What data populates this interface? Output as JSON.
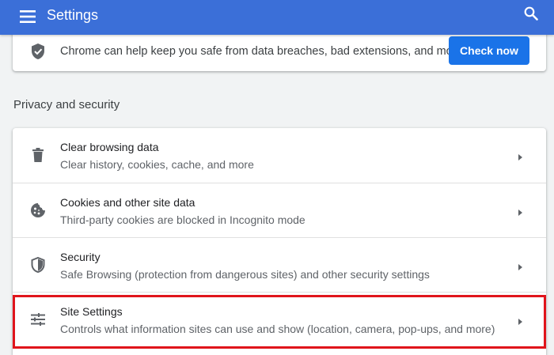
{
  "header": {
    "title": "Settings",
    "menu_icon": "hamburger-menu-icon",
    "search_icon": "search-icon",
    "background_color": "#3b6fd8"
  },
  "safety_check": {
    "icon": "shield-check-icon",
    "text": "Chrome can help keep you safe from data breaches, bad extensions, and more",
    "button_label": "Check now",
    "button_color": "#1a73e8"
  },
  "privacy": {
    "section_title": "Privacy and security",
    "items": [
      {
        "icon": "trash-icon",
        "title": "Clear browsing data",
        "subtitle": "Clear history, cookies, cache, and more"
      },
      {
        "icon": "cookie-icon",
        "title": "Cookies and other site data",
        "subtitle": "Third-party cookies are blocked in Incognito mode"
      },
      {
        "icon": "shield-icon",
        "title": "Security",
        "subtitle": "Safe Browsing (protection from dangerous sites) and other security settings"
      },
      {
        "icon": "tune-sliders-icon",
        "title": "Site Settings",
        "subtitle": "Controls what information sites can use and show (location, camera, pop-ups, and more)",
        "highlighted": true
      }
    ]
  },
  "highlight_color": "#e0141b"
}
